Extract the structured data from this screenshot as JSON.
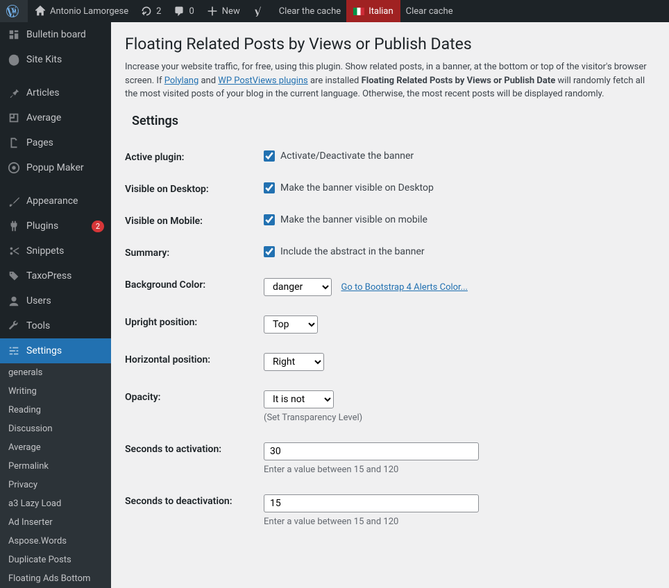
{
  "toolbar": {
    "site_name": "Antonio Lamorgese",
    "updates_count": "2",
    "comments_count": "0",
    "new_label": "New",
    "clear_cache_label": "Clear the cache",
    "italian_label": "Italian",
    "clear_cache2_label": "Clear cache"
  },
  "sidebar": {
    "items": [
      {
        "label": "Bulletin board"
      },
      {
        "label": "Site Kits"
      },
      {
        "label": "Articles"
      },
      {
        "label": "Average"
      },
      {
        "label": "Pages"
      },
      {
        "label": "Popup Maker"
      },
      {
        "label": "Appearance"
      },
      {
        "label": "Plugins",
        "badge": "2"
      },
      {
        "label": "Snippets"
      },
      {
        "label": "TaxoPress"
      },
      {
        "label": "Users"
      },
      {
        "label": "Tools"
      },
      {
        "label": "Settings"
      }
    ],
    "submenu": [
      {
        "label": "generals"
      },
      {
        "label": "Writing"
      },
      {
        "label": "Reading"
      },
      {
        "label": "Discussion"
      },
      {
        "label": "Average"
      },
      {
        "label": "Permalink"
      },
      {
        "label": "Privacy"
      },
      {
        "label": "a3 Lazy Load"
      },
      {
        "label": "Ad Inserter"
      },
      {
        "label": "Aspose.Words"
      },
      {
        "label": "Duplicate Posts"
      },
      {
        "label": "Floating Ads Bottom"
      }
    ]
  },
  "page": {
    "title": "Floating Related Posts by Views or Publish Dates",
    "intro_1": "Increase your website traffic, for free, using this plugin. Show related posts, in a banner, at the bottom or top of the visitor's browser screen. If ",
    "intro_link1": "Polylang",
    "intro_2": " and ",
    "intro_link2": "WP PostViews plugins",
    "intro_3": " are installed ",
    "intro_bold": "Floating Related Posts by Views or Publish Date",
    "intro_4": " will randomly fetch all the most visited posts of your blog in the current language. Otherwise, the most recent posts will be displayed randomly.",
    "settings_heading": "Settings"
  },
  "form": {
    "active_plugin": {
      "label": "Active plugin:",
      "text": "Activate/Deactivate the banner"
    },
    "visible_desktop": {
      "label": "Visible on Desktop:",
      "text": "Make the banner visible on Desktop"
    },
    "visible_mobile": {
      "label": "Visible on Mobile:",
      "text": "Make the banner visible on mobile"
    },
    "summary": {
      "label": "Summary:",
      "text": "Include the abstract in the banner"
    },
    "bg_color": {
      "label": "Background Color:",
      "value": "danger",
      "link": "Go to Bootstrap 4 Alerts Color..."
    },
    "upright": {
      "label": "Upright position:",
      "value": "Top"
    },
    "horizontal": {
      "label": "Horizontal position:",
      "value": "Right"
    },
    "opacity": {
      "label": "Opacity:",
      "value": "It is not",
      "help": "(Set Transparency Level)"
    },
    "sec_activate": {
      "label": "Seconds to activation:",
      "value": "30",
      "help": "Enter a value between 15 and 120"
    },
    "sec_deactivate": {
      "label": "Seconds to deactivation:",
      "value": "15",
      "help": "Enter a value between 15 and 120"
    }
  }
}
